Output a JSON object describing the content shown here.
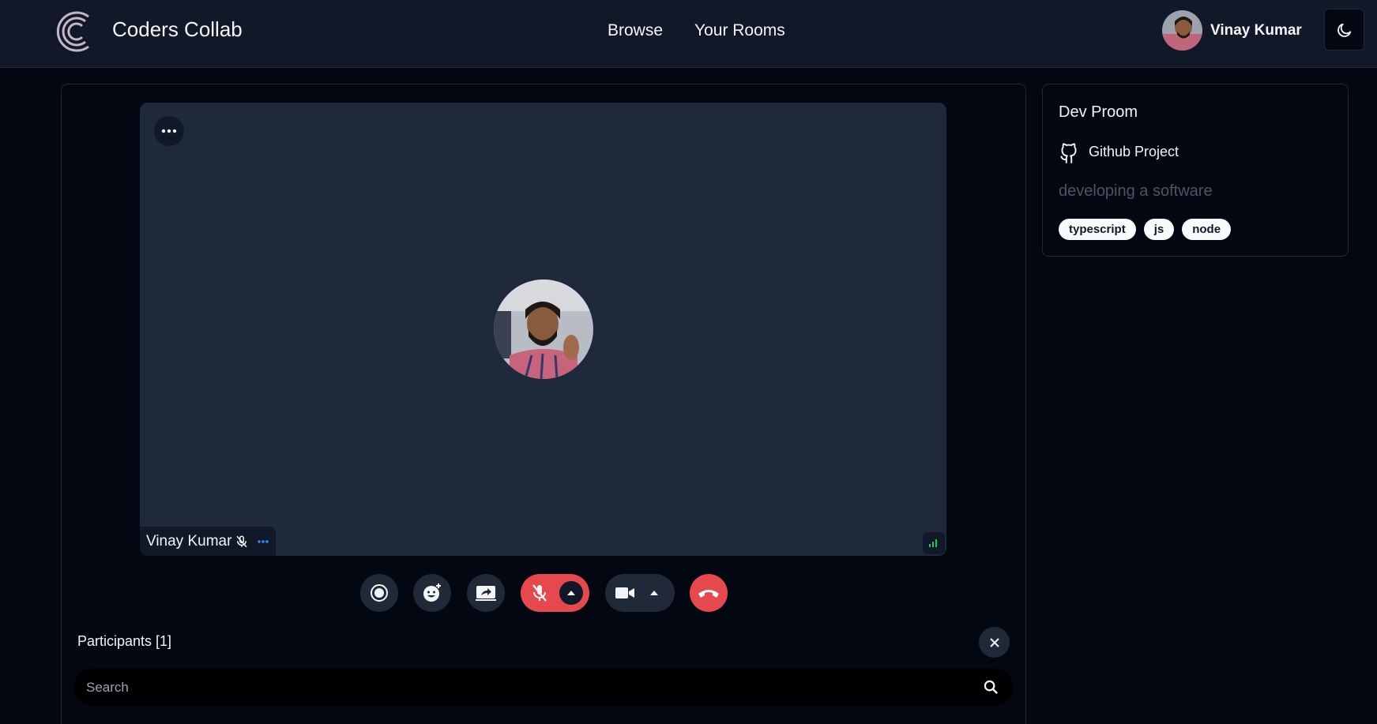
{
  "app": {
    "brand": "Coders Collab",
    "nav": [
      {
        "label": "Browse"
      },
      {
        "label": "Your Rooms"
      }
    ],
    "user_name": "Vinay Kumar"
  },
  "call": {
    "participant_name": "Vinay Kumar",
    "participants_title": "Participants [1]",
    "search_placeholder": "Search"
  },
  "room": {
    "name": "Dev Proom",
    "github_label": "Github Project",
    "description": "developing a software",
    "tags": [
      "typescript",
      "js",
      "node"
    ]
  },
  "colors": {
    "background": "#030712",
    "header": "#111827",
    "tile": "#1e293b",
    "danger": "#e5484d",
    "signal": "#22c55e",
    "menu_dots": "#3b82f6"
  },
  "icons": [
    "logo-icon",
    "moon-icon",
    "more-icon",
    "mic-off-icon",
    "signal-icon",
    "record-icon",
    "emoji-icon",
    "screen-share-icon",
    "chevron-up-icon",
    "camera-icon",
    "phone-hangup-icon",
    "close-icon",
    "search-icon",
    "github-icon"
  ]
}
